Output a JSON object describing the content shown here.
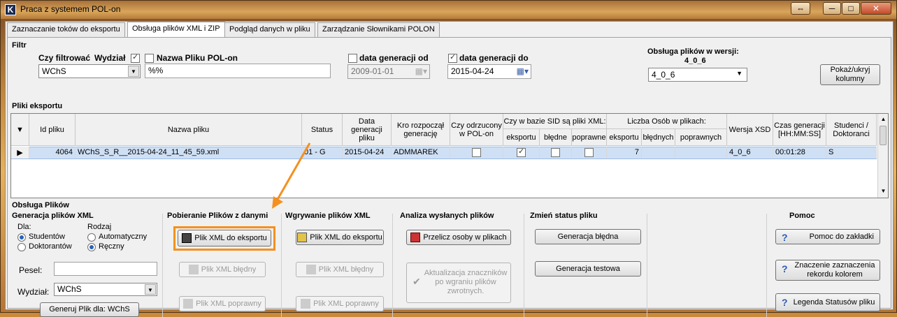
{
  "window": {
    "title": "Praca z systemem POL-on",
    "app_icon": "K",
    "controls": [
      "⇔",
      "─",
      "□",
      "✕"
    ]
  },
  "tabs": [
    "Zaznaczanie toków do eksportu",
    "Obsługa plików XML i ZIP",
    "Podgląd danych w pliku",
    "Zarządzanie Słownikami POLON"
  ],
  "filter": {
    "label": "Filtr",
    "czy_filtrowac": "Czy filtrować",
    "wydzial_label": "Wydział",
    "wydzial_value": "WChS",
    "nazwa_label": "Nazwa Pliku POL-on",
    "nazwa_value": "%%",
    "data_od_label": "data generacji od",
    "data_od_value": "2009-01-01",
    "data_do_label": "data generacji do",
    "data_do_value": "2015-04-24",
    "wersja_label": "Obsługa plików w wersji:",
    "wersja_sub": "4_0_6",
    "wersja_value": "4_0_6",
    "pokaz_button": "Pokaż/ukryj kolumny"
  },
  "grid": {
    "label": "Pliki eksportu",
    "headers": {
      "id": "Id pliku",
      "nazwa": "Nazwa pliku",
      "status": "Status",
      "data": "Data generacji pliku",
      "kro": "Kro rozpoczął generację",
      "odrzucony": "Czy odrzucony w POL-on",
      "sid_group": "Czy w bazie SID są pliki XML:",
      "sid_eksportu": "eksportu",
      "sid_bledne": "błędne",
      "sid_poprawne": "poprawne",
      "osob_group": "Liczba Osób w plikach:",
      "osob_eksportu": "eksportu",
      "osob_bledne": "błędnych",
      "osob_poprawne": "poprawnych",
      "wersja": "Wersja XSD",
      "czas": "Czas generacji [HH:MM:SS]",
      "studenci": "Studenci / Doktoranci"
    },
    "row": {
      "id": "4064",
      "nazwa": "WChS_S_R__2015-04-24_11_45_59.xml",
      "status": "01 - G",
      "data": "2015-04-24",
      "kro": "ADMMAREK",
      "eksportu_count": "7",
      "wersja": "4_0_6",
      "czas": "00:01:28",
      "studenci": "S"
    }
  },
  "obsluga": {
    "label": "Obsługa Plików",
    "generacja": {
      "label": "Generacja plików XML",
      "dla_label": "Dla:",
      "studentow": "Studentów",
      "doktorantow": "Doktorantów",
      "rodzaj_label": "Rodzaj",
      "automatyczny": "Automatyczny",
      "reczny": "Ręczny",
      "pesel_label": "Pesel:",
      "wydzial_label": "Wydział:",
      "wydzial_value": "WChS",
      "generuj_button": "Generuj Plik dla: WChS"
    },
    "pobieranie": {
      "label": "Pobieranie Plików z danymi",
      "eksport": "Plik XML do eksportu",
      "bledny": "Plik XML błędny",
      "poprawny": "Plik XML poprawny"
    },
    "wgrywanie": {
      "label": "Wgrywanie plików XML",
      "eksport": "Plik XML do eksportu",
      "bledny": "Plik XML błędny",
      "poprawny": "Plik XML poprawny"
    },
    "analiza": {
      "label": "Analiza wysłanych plików",
      "przelicz": "Przelicz osoby w plikach",
      "aktualizacja": "Aktualizacja znaczników po wgraniu plików zwrotnych."
    },
    "status": {
      "label": "Zmień status pliku",
      "bledna": "Generacja błędna",
      "testowa": "Generacja testowa"
    },
    "pomoc": {
      "label": "Pomoc",
      "zakladki": "Pomoc do zakładki",
      "znaczenie": "Znaczenie zaznaczenia rekordu kolorem",
      "legenda": "Legenda Statusów pliku"
    }
  },
  "colors": {
    "highlight": "#f5901e",
    "selected_row": "#cfe0f5"
  }
}
